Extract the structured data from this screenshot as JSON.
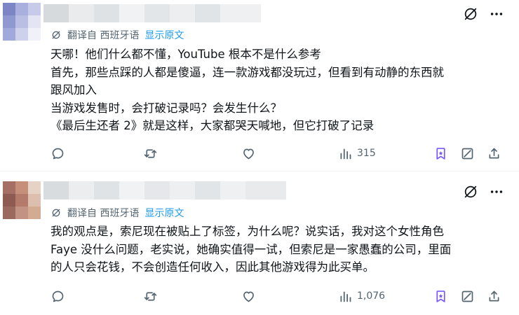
{
  "colors": {
    "accent": "#1d9bf0",
    "muted": "#536471",
    "text": "#0f1419",
    "bookmark": "#7856ff"
  },
  "posts": [
    {
      "translate": {
        "label": "翻译自 西班牙语",
        "show_original": "显示原文"
      },
      "body": [
        "天哪！他们什么都不懂，YouTube 根本不是什么参考",
        "首先，那些点踩的人都是傻逼，连一款游戏都没玩过，但看到有动静的东西就",
        "跟风加入",
        "当游戏发售时，会打破记录吗？会发生什么？",
        "《最后生还者 2》就是这样，大家都哭天喊地，但它打破了记录"
      ],
      "views": "315",
      "icons": [
        "reply-icon",
        "retweet-icon",
        "like-icon",
        "views-icon",
        "bookmark-icon",
        "share-icon"
      ]
    },
    {
      "translate": {
        "label": "翻译自 西班牙语",
        "show_original": "显示原文"
      },
      "body": [
        "我的观点是，索尼现在被贴上了标签，为什么呢？说实话，我对这个女性角色",
        "Faye 没什么问题，老实说，她确实值得一试，但索尼是一家愚蠢的公司，里面",
        "的人只会花钱，不会创造任何收入，因此其他游戏得为此买单。"
      ],
      "views": "1,076",
      "icons": [
        "reply-icon",
        "retweet-icon",
        "like-icon",
        "views-icon",
        "bookmark-icon",
        "share-icon"
      ]
    }
  ]
}
